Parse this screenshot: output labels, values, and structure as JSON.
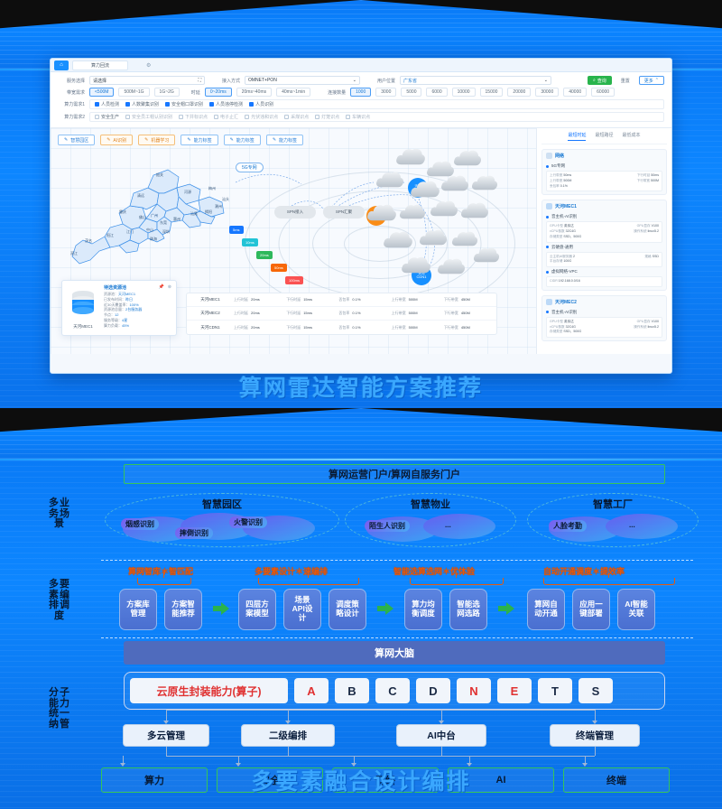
{
  "top_panel": {
    "caption": "算网雷达智能方案推荐",
    "tabs": {
      "home_icon": "home-icon",
      "doc_tab": "算力回流",
      "gear_icon": "gear-icon"
    },
    "filters": {
      "row1": [
        {
          "label": "服务选择",
          "value": "请选择",
          "icon": "expand-icon"
        },
        {
          "label": "接入方式",
          "value": "OMNET+PON",
          "icon": "chevron-down-icon"
        },
        {
          "label": "用户位置",
          "value": "广东省",
          "icon": "chevron-down-icon"
        }
      ],
      "bandwidth": {
        "label": "带宽需求",
        "options": [
          "<500M",
          "500M~1G",
          "1G~2G"
        ],
        "selected": "<500M"
      },
      "latency": {
        "label": "时延",
        "options": [
          "0~20ms",
          "20ms~40ms",
          "40ms~1min"
        ],
        "selected": "0~20ms"
      },
      "connections": {
        "label": "连接数量",
        "options": [
          "1000",
          "3000",
          "5000",
          "6000",
          "10000",
          "15000",
          "20000",
          "30000",
          "40000",
          "60000"
        ],
        "selected": "1000"
      },
      "req1": {
        "label": "算力需求1",
        "items": [
          "人员检测",
          "人数聚集识别",
          "安全帽口罩识别",
          "人员违停检测",
          "人员识别"
        ]
      },
      "req2": {
        "label": "算力需求2",
        "items": [
          "安全生产",
          "安全员工帽认别识别",
          "下井标识点",
          "电子止汇",
          "光伏违和识点",
          "采煤识点",
          "灯笼识点",
          "车辆识点"
        ]
      },
      "actions": {
        "search": "查询",
        "reset": "重置",
        "more": "更多"
      }
    },
    "tags": [
      {
        "label": "智慧园区",
        "style": "blue"
      },
      {
        "label": "AI识别",
        "style": "orange"
      },
      {
        "label": "机器学习",
        "style": "orange"
      },
      {
        "label": "能力标签",
        "style": "blue"
      },
      {
        "label": "能力标签",
        "style": "blue"
      },
      {
        "label": "能力标签",
        "style": "blue"
      }
    ],
    "map": {
      "province": "广东省",
      "cities": [
        "韶关",
        "清远",
        "河源",
        "梅州",
        "肇庆",
        "广州",
        "惠州",
        "汕头",
        "潮州",
        "揭阳",
        "汕尾",
        "江门",
        "佛山",
        "东莞",
        "中山",
        "深圳",
        "珠海",
        "阳江",
        "茂名",
        "湛江"
      ],
      "network_label": "5G专网"
    },
    "nodes": [
      {
        "label": "SPN接入",
        "type": "grey"
      },
      {
        "label": "SPN汇聚",
        "type": "grey"
      },
      {
        "label": "天河MEC1",
        "type": "blue"
      },
      {
        "label": "天河MEC2",
        "type": "orange"
      },
      {
        "label": "天河CDN1",
        "type": "blue"
      }
    ],
    "latency_legend": [
      {
        "value": "5ms",
        "color": "#1677ff"
      },
      {
        "value": "10ms",
        "color": "#22c3d6"
      },
      {
        "value": "20ms",
        "color": "#2eb85c"
      },
      {
        "value": "50ms",
        "color": "#f76707"
      },
      {
        "value": "100ms",
        "color": "#fa5252"
      }
    ],
    "info_card": {
      "title": "待选资源池",
      "rows": [
        {
          "k": "资源池：",
          "v": "天河MEC1"
        },
        {
          "k": "已发布时间：",
          "v": "昨日"
        },
        {
          "k": "近30天覆盖率：",
          "v": "100%"
        },
        {
          "k": "资源池总量：",
          "v": "2台服务器"
        },
        {
          "k": "节点：",
          "v": "12"
        },
        {
          "k": "服务等级：",
          "v": "4星"
        },
        {
          "k": "算力负载：",
          "v": "45%"
        }
      ],
      "name": "天河MEC1"
    },
    "metrics_table": {
      "rows": [
        {
          "name": "天河MEC1",
          "cells": [
            [
              "上行时延",
              "20ms"
            ],
            [
              "下行时延",
              "15ms"
            ],
            [
              "丢包率",
              "0.1%"
            ],
            [
              "上行带宽",
              "500M"
            ],
            [
              "下行带宽",
              "450M"
            ]
          ]
        },
        {
          "name": "天河MEC2",
          "cells": [
            [
              "上行时延",
              "20ms"
            ],
            [
              "下行时延",
              "15ms"
            ],
            [
              "丢包率",
              "0.1%"
            ],
            [
              "上行带宽",
              "500M"
            ],
            [
              "下行带宽",
              "450M"
            ]
          ]
        },
        {
          "name": "天河CDN1",
          "cells": [
            [
              "上行时延",
              "20ms"
            ],
            [
              "下行时延",
              "15ms"
            ],
            [
              "丢包率",
              "0.1%"
            ],
            [
              "上行带宽",
              "500M"
            ],
            [
              "下行带宽",
              "450M"
            ]
          ]
        }
      ]
    },
    "side": {
      "tabs": [
        "最短时延",
        "最短路径",
        "最低成本"
      ],
      "active_tab": "最短时延",
      "panels": [
        {
          "title": "网络",
          "icon": "globe-icon",
          "groups": [
            {
              "name": "5G专网",
              "kvs": [
                [
                  "上行带宽",
                  "50ms"
                ],
                [
                  "下行时延",
                  "50ms"
                ],
                [
                  "上行带宽",
                  "500M"
                ],
                [
                  "下行带宽",
                  "500M"
                ],
                [
                  "丢包率",
                  "0.1%"
                ]
              ]
            }
          ]
        },
        {
          "title": "天河MEC1",
          "icon": "server-icon",
          "groups": [
            {
              "name": "音主机-AI识别",
              "kvs": [
                [
                  "GPU卡型",
                  "英伟达"
                ],
                [
                  "GPU显存",
                  "V100"
                ],
                [
                  "vCPU核数",
                  "32C4G"
                ],
                [
                  "操作系统",
                  "linux5.2"
                ],
                [
                  "存储类型",
                  "SSD、500G"
                ]
              ]
            },
            {
              "name": "云硬盘-通用",
              "kvs": [
                [
                  "云主机AI服务器",
                  "2"
                ],
                [
                  "规格",
                  "SSD"
                ],
                [
                  "平台存储",
                  "100G"
                ]
              ]
            },
            {
              "name": "虚拟网络-VPC",
              "kvs": [
                [
                  "CIDR",
                  "192.168.0.0/16"
                ]
              ]
            }
          ]
        },
        {
          "title": "天河MEC2",
          "icon": "server-icon",
          "groups": [
            {
              "name": "音主机-AI识别",
              "kvs": [
                [
                  "GPU卡型",
                  "英伟达"
                ],
                [
                  "GPU显存",
                  "V100"
                ],
                [
                  "vCPU核数",
                  "32C4G"
                ],
                [
                  "操作系统",
                  "linux5.2"
                ],
                [
                  "存储类型",
                  "SSD、500G"
                ]
              ]
            }
          ]
        }
      ]
    }
  },
  "bottom_panel": {
    "caption": "多要素融合设计编排",
    "portal": "算网运营门户/算网自服务门户",
    "vertical_labels": [
      "多业\n务场\n景",
      "多要\n素编\n排调\n度",
      "分子\n能力\n统一\n纳管"
    ],
    "scenes": [
      {
        "title": "智慧园区",
        "bubbles": [
          "烟感识别",
          "摔倒识别",
          "火警识别"
        ]
      },
      {
        "title": "智慧物业",
        "bubbles": [
          "陌生人识别",
          "..."
        ]
      },
      {
        "title": "智慧工厂",
        "bubbles": [
          "人脸考勤",
          "..."
        ]
      }
    ],
    "orange_labels": [
      "算网智库＊智匹配",
      "多要素设计＊速编排",
      "智能选算选网＊优体验",
      "自动开通调度＊提效率"
    ],
    "orchestration_groups": [
      {
        "boxes": [
          "方案库\n管理",
          "方案智\n能推荐"
        ]
      },
      {
        "boxes": [
          "四层方\n案模型",
          "场景\nAPI设\n计",
          "调度策\n略设计"
        ]
      },
      {
        "boxes": [
          "算力均\n衡调度",
          "智能选\n网选路"
        ]
      },
      {
        "boxes": [
          "算网自\n动开通",
          "应用一\n键部署",
          "AI智能\n关联"
        ]
      }
    ],
    "brain": "算网大脑",
    "capsule": {
      "main": "云原生封装能力(算子)",
      "letters": [
        "A",
        "B",
        "C",
        "D",
        "N",
        "E",
        "T",
        "S"
      ],
      "red_letters": [
        "A",
        "N",
        "E"
      ]
    },
    "mid_boxes": [
      "多云管理",
      "二级编排",
      "AI中台",
      "终端管理"
    ],
    "bottom_boxes": [
      "算力",
      "安全",
      "网络",
      "AI",
      "终端"
    ]
  },
  "colors": {
    "brand_blue": "#0d86ff",
    "accent_green": "#35c45a",
    "accent_orange": "#e8590c",
    "caption_blue": "#3aa7ff",
    "red": "#e03131"
  }
}
